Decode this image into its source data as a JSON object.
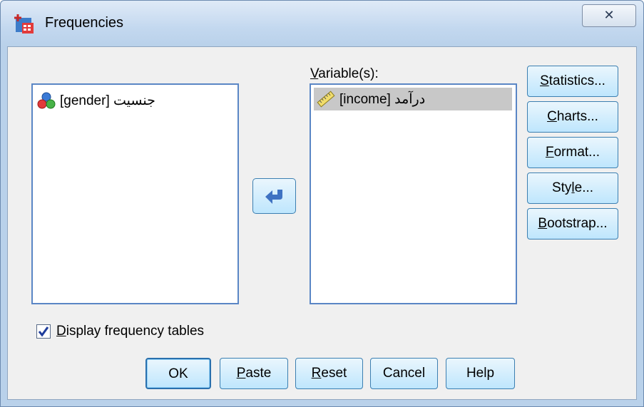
{
  "window": {
    "title": "Frequencies",
    "close_glyph": "✕",
    "app_icon": "frequencies-icon"
  },
  "source_list": {
    "items": [
      {
        "label": "[gender] جنسیت",
        "icon": "nominal-variable-icon"
      }
    ]
  },
  "target_list": {
    "label": "Variable(s):",
    "items": [
      {
        "label": "[income] درآمد",
        "icon": "scale-variable-icon",
        "selected": true
      }
    ]
  },
  "move_button": {
    "icon": "move-left-arrow-icon"
  },
  "side_buttons": [
    {
      "label": "Statistics..."
    },
    {
      "label": "Charts..."
    },
    {
      "label": "Format..."
    },
    {
      "label": "Style..."
    },
    {
      "label": "Bootstrap..."
    }
  ],
  "checkbox": {
    "label": "Display frequency tables",
    "checked": true
  },
  "bottom_buttons": [
    {
      "label": "OK"
    },
    {
      "label": "Paste"
    },
    {
      "label": "Reset"
    },
    {
      "label": "Cancel"
    },
    {
      "label": "Help"
    }
  ],
  "colors": {
    "accent": "#5a86c5",
    "selection": "#c8c8c8"
  }
}
